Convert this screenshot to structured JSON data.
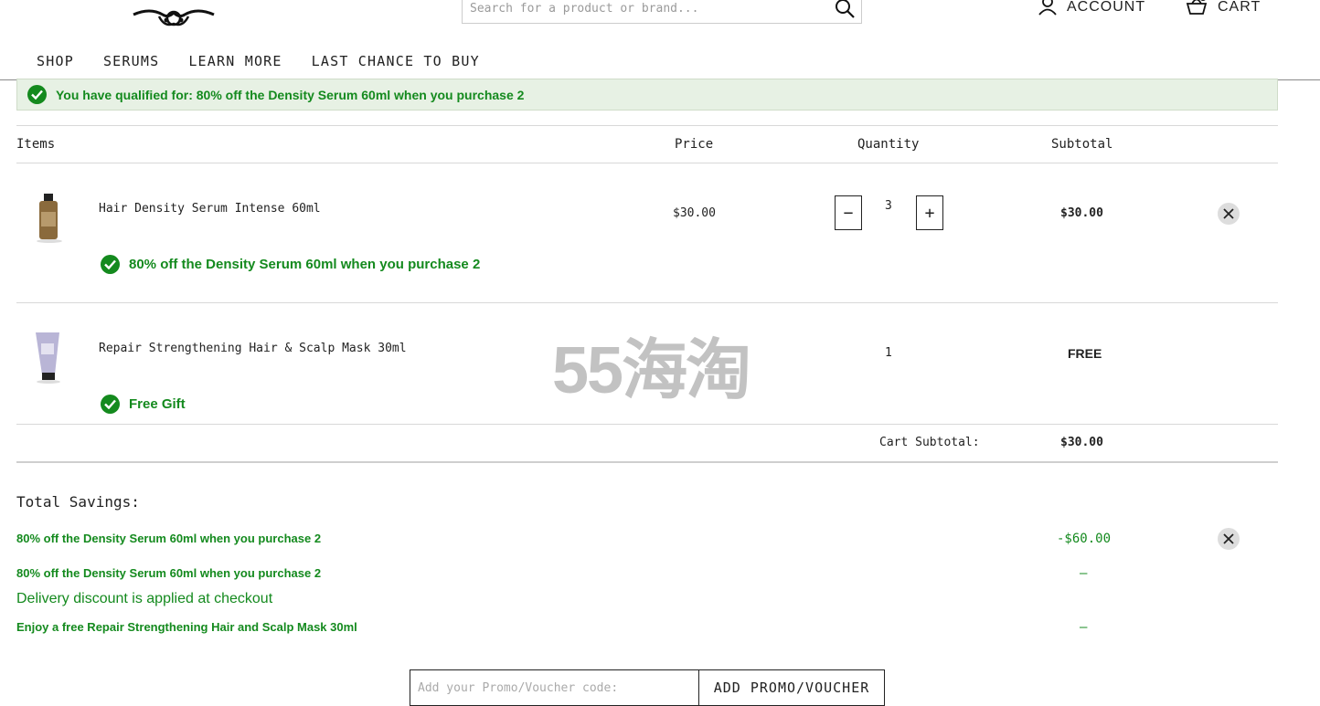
{
  "header": {
    "search_placeholder": "Search for a product or brand...",
    "account_label": "ACCOUNT",
    "cart_label": "CART",
    "icons": {
      "search": "search-icon",
      "account": "user-icon",
      "cart": "basket-icon",
      "logo": "ornamental-logo"
    }
  },
  "nav": {
    "items": [
      "SHOP",
      "SERUMS",
      "LEARN MORE",
      "LAST CHANCE TO BUY"
    ]
  },
  "banner": {
    "text": "You have qualified for: 80% off the Density Serum 60ml when you purchase 2",
    "color": "#148a1e"
  },
  "table": {
    "headers": {
      "items": "Items",
      "price": "Price",
      "quantity": "Quantity",
      "subtotal": "Subtotal"
    },
    "rows": [
      {
        "name": "Hair Density Serum Intense 60ml",
        "price": "$30.00",
        "quantity": "3",
        "subtotal": "$30.00",
        "promo": "80% off the Density Serum 60ml when you purchase 2"
      },
      {
        "name": "Repair Strengthening Hair & Scalp Mask 30ml",
        "price": "",
        "quantity": "1",
        "subtotal": "FREE",
        "promo": "Free Gift"
      }
    ],
    "cart_subtotal_label": "Cart Subtotal:",
    "cart_subtotal_value": "$30.00"
  },
  "savings": {
    "title": "Total Savings:",
    "lines": [
      {
        "label": "80% off the Density Serum 60ml when you purchase 2",
        "value": "-$60.00"
      },
      {
        "label": "80% off the Density Serum 60ml when you purchase 2",
        "value": "–"
      },
      {
        "label": "Delivery discount is applied at checkout",
        "value": ""
      },
      {
        "label": "Enjoy a free Repair Strengthening Hair and Scalp Mask 30ml",
        "value": "–"
      }
    ]
  },
  "promo": {
    "placeholder": "Add your Promo/Voucher code:",
    "button_label": "ADD PROMO/VOUCHER"
  },
  "watermark": "55海淘"
}
